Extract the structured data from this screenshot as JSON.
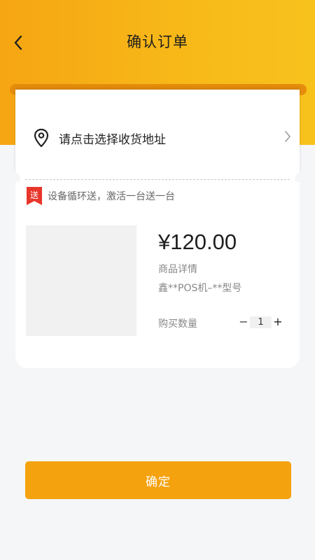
{
  "header": {
    "title": "确认订单",
    "back_icon": "chevron-left-icon",
    "colors": {
      "gradient_start": "#f6a513",
      "gradient_end": "#f8c21d"
    }
  },
  "address": {
    "placeholder_text": "请点击选择收货地址",
    "icon": "location-pin-icon",
    "chevron_icon": "chevron-right-icon"
  },
  "promo": {
    "tag": "送",
    "text": "设备循环送，激活一台送一台",
    "tag_color": "#e8362b"
  },
  "product": {
    "price": "¥120.00",
    "detail_label": "商品详情",
    "model": "鑫**POS机–**型号",
    "quantity_label": "购买数量",
    "quantity_minus": "−",
    "quantity_value": "1",
    "quantity_plus": "+"
  },
  "footer": {
    "confirm_label": "确定",
    "button_color": "#f5a20f"
  }
}
